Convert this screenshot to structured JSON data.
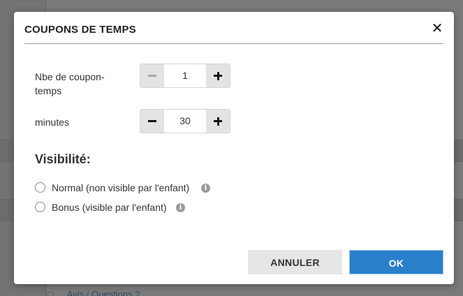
{
  "dialog": {
    "title": "COUPONS DE TEMPS",
    "close_glyph": "✕"
  },
  "coupons": {
    "label": "Nbe de coupon-temps",
    "value": "1",
    "minus_disabled": true
  },
  "minutes": {
    "label": "minutes",
    "value": "30"
  },
  "visibility": {
    "heading": "Visibilité:",
    "options": [
      {
        "label": "Normal (non visible par l'enfant)",
        "selected": false,
        "info_icon": "info-icon"
      },
      {
        "label": "Bonus (visible par l'enfant)",
        "selected": false,
        "info_icon": "info-icon"
      }
    ]
  },
  "actions": {
    "cancel_label": "ANNULER",
    "ok_label": "OK"
  },
  "background": {
    "bottom_link": "Avis / Questions ?"
  },
  "colors": {
    "primary": "#2a7fcb",
    "secondary_button": "#e6e6e6",
    "stepper_button": "#e3e3e3",
    "overlay": "#6f6f6f"
  }
}
